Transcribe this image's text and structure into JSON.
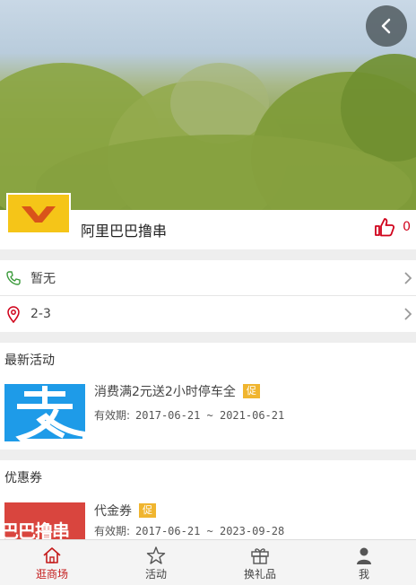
{
  "store": {
    "name": "阿里巴巴撸串",
    "likes": "0",
    "logo_color": "#f5c518"
  },
  "info": {
    "phone": "暂无",
    "location": "2-3"
  },
  "activities": {
    "title": "最新活动",
    "items": [
      {
        "title": "消费满2元送2小时停车全",
        "tag": "促",
        "validity_label": "有效期:",
        "validity": "2017-06-21 ~ 2021-06-21"
      }
    ]
  },
  "coupons": {
    "title": "优惠券",
    "items": [
      {
        "thumb_text": "巴巴撸串",
        "title": "代金券",
        "tag": "促",
        "validity_label": "有效期:",
        "validity": "2017-06-21 ~ 2023-09-28"
      }
    ]
  },
  "tabs": [
    {
      "label": "逛商场",
      "icon": "house-icon",
      "active": true
    },
    {
      "label": "活动",
      "icon": "star-icon",
      "active": false
    },
    {
      "label": "换礼品",
      "icon": "gift-icon",
      "active": false
    },
    {
      "label": "我",
      "icon": "person-icon",
      "active": false
    }
  ],
  "colors": {
    "accent": "#c41b1b",
    "tag": "#f0b52f",
    "alipay": "#1e9be8"
  }
}
